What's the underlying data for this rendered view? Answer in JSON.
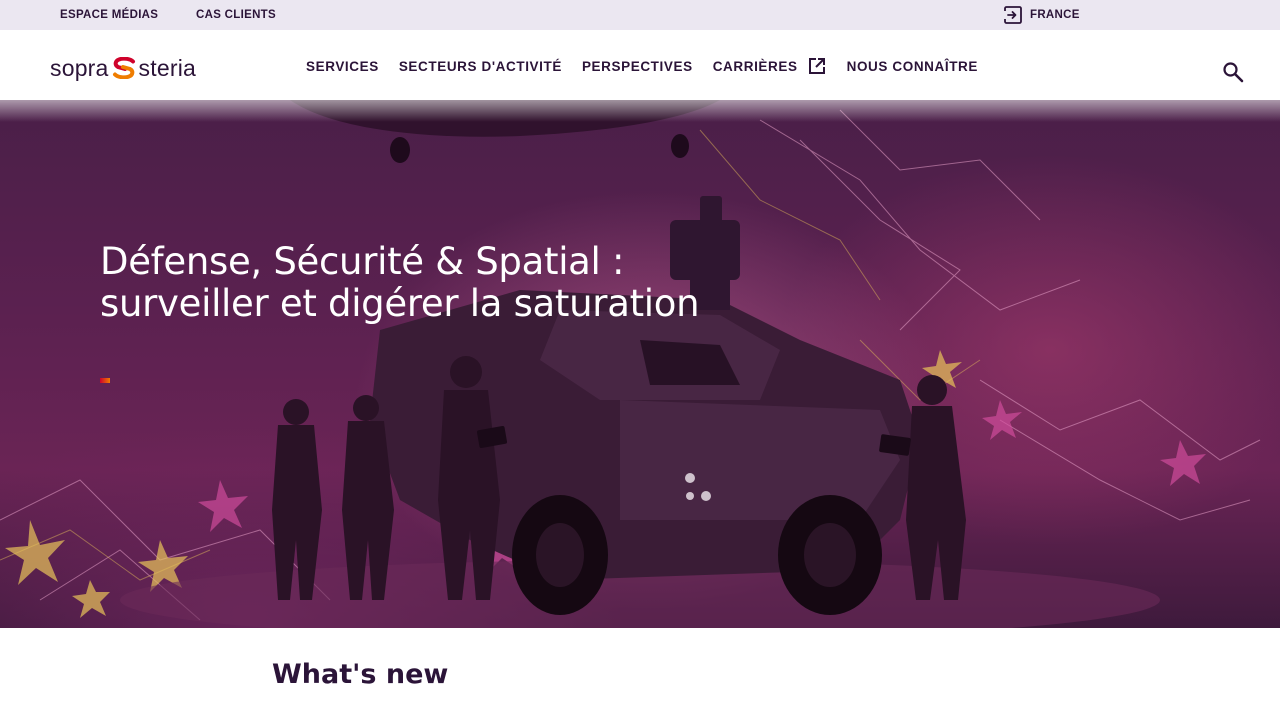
{
  "utility_bar": {
    "links": [
      "ESPACE MÉDIAS",
      "CAS CLIENTS"
    ],
    "language": "FRANCE",
    "language_icon": "sign-in-icon"
  },
  "header": {
    "logo": {
      "left": "sopra",
      "right": "steria",
      "icon": "sopra-steria-s-logo-icon"
    },
    "nav": [
      "SERVICES",
      "SECTEURS D'ACTIVITÉ",
      "PERSPECTIVES",
      "CARRIÈRES",
      "NOUS CONNAÎTRE"
    ],
    "careers_icon": "external-link-icon",
    "search_icon": "search-icon"
  },
  "hero": {
    "title": "Défense, Sécurité & Spatial : surveiller et digérer la saturation"
  },
  "section": {
    "title": "What's new"
  },
  "colors": {
    "brand_purple": "#2b1438",
    "brand_red": "#cf022b",
    "brand_orange": "#ef7d00",
    "utility_bg": "#ebe7f1"
  }
}
